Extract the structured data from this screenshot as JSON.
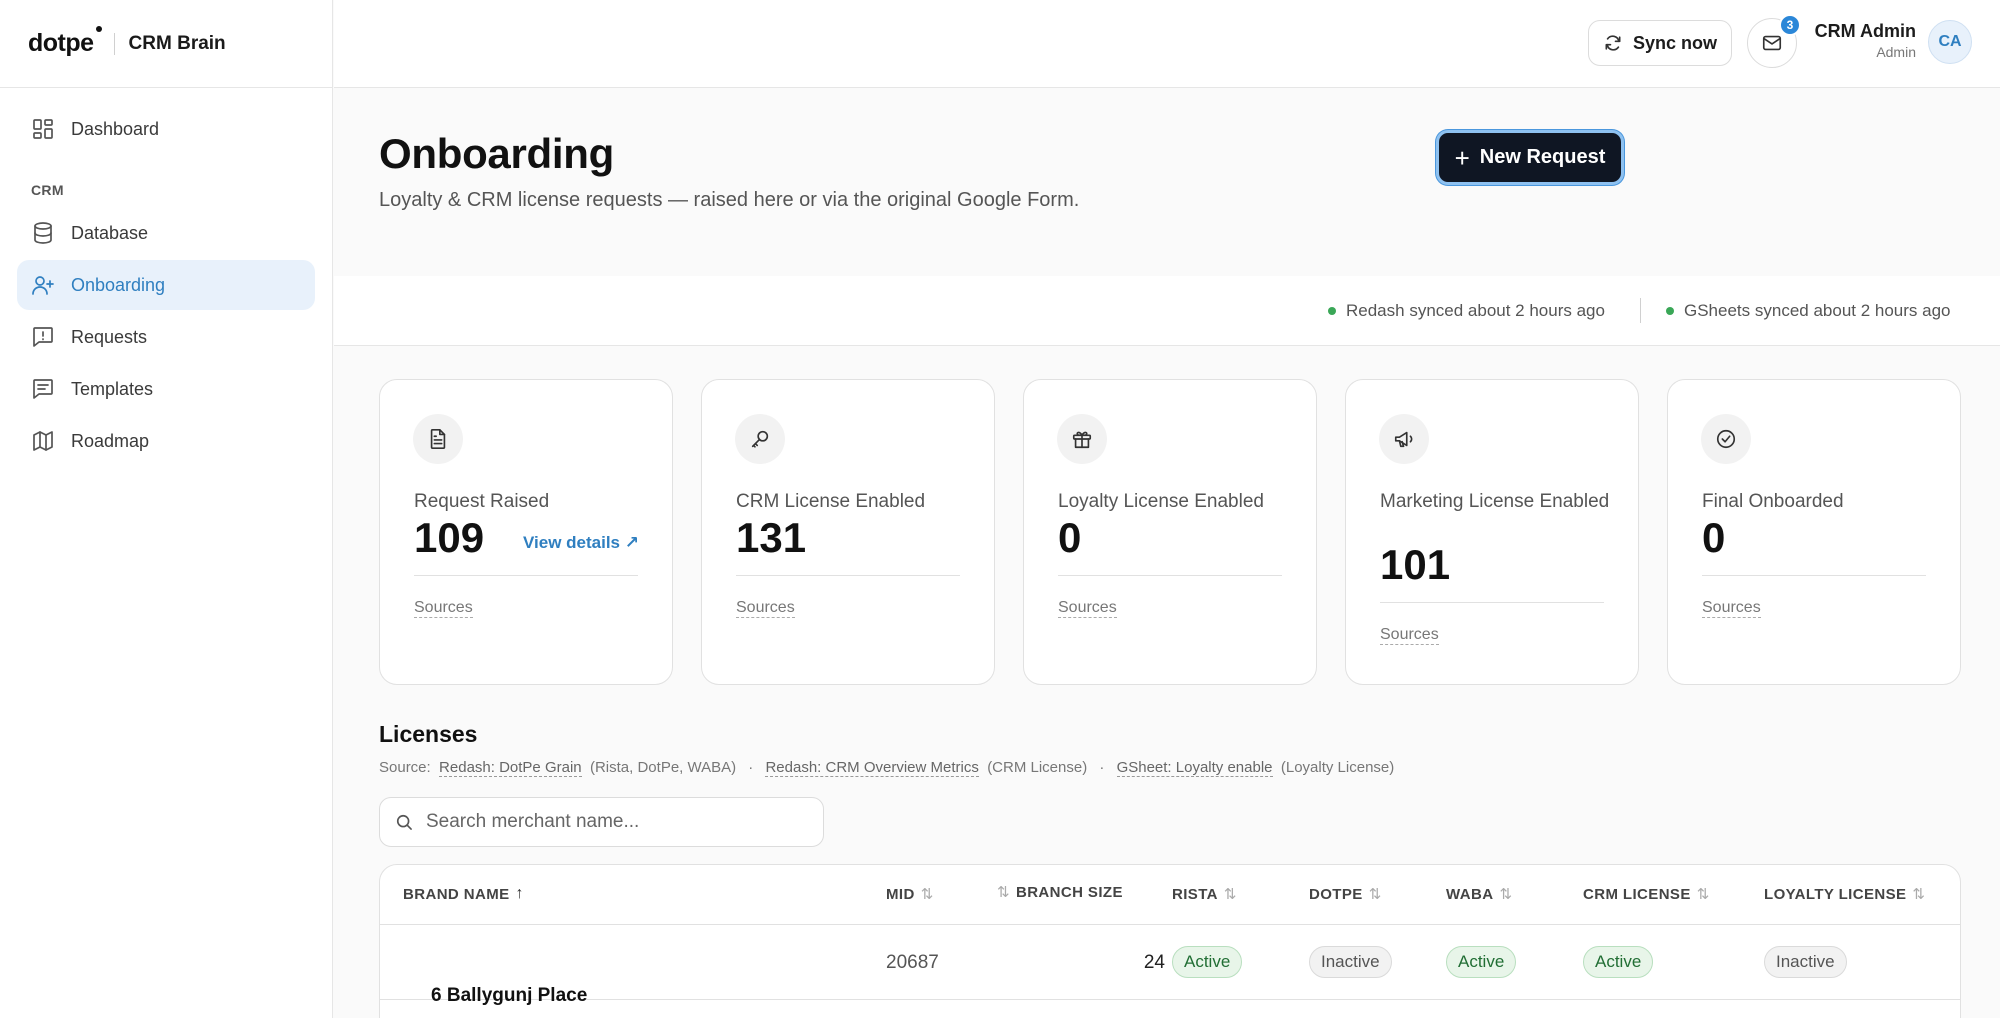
{
  "brand": {
    "logo": "dotpe",
    "name": "CRM Brain"
  },
  "sidebar": {
    "items_top": [
      {
        "label": "Dashboard",
        "icon": "dashboard-icon"
      }
    ],
    "section": "CRM",
    "items": [
      {
        "label": "Database",
        "icon": "database-icon"
      },
      {
        "label": "Onboarding",
        "icon": "user-plus-icon",
        "active": true
      },
      {
        "label": "Requests",
        "icon": "alert-message-icon"
      },
      {
        "label": "Templates",
        "icon": "message-lines-icon"
      },
      {
        "label": "Roadmap",
        "icon": "map-icon"
      }
    ]
  },
  "topbar": {
    "sync_label": "Sync now",
    "mail_badge": "3",
    "user_name": "CRM Admin",
    "user_role": "Admin",
    "avatar_initials": "CA"
  },
  "header": {
    "title": "Onboarding",
    "subtitle": "Loyalty & CRM license requests — raised here or via the original Google Form.",
    "new_request_label": "New Request"
  },
  "sync_status": [
    {
      "text": "Redash synced about 2 hours ago"
    },
    {
      "text": "GSheets synced about 2 hours ago"
    }
  ],
  "cards": [
    {
      "label": "Request Raised",
      "value": "109",
      "link": "View details ↗",
      "sources": "Sources",
      "icon": "document-icon"
    },
    {
      "label": "CRM License Enabled",
      "value": "131",
      "sources": "Sources",
      "icon": "key-icon"
    },
    {
      "label": "Loyalty License Enabled",
      "value": "0",
      "sources": "Sources",
      "icon": "gift-icon"
    },
    {
      "label": "Marketing License Enabled",
      "value": "101",
      "sources": "Sources",
      "icon": "megaphone-icon"
    },
    {
      "label": "Final Onboarded",
      "value": "0",
      "sources": "Sources",
      "icon": "check-circle-icon"
    }
  ],
  "licenses": {
    "title": "Licenses",
    "source_prefix": "Source:",
    "sources": [
      {
        "link": "Redash: DotPe Grain",
        "note": "(Rista, DotPe, WABA)"
      },
      {
        "link": "Redash: CRM Overview Metrics",
        "note": "(CRM License)"
      },
      {
        "link": "GSheet: Loyalty enable",
        "note": "(Loyalty License)"
      }
    ],
    "separator": "·",
    "search_placeholder": "Search merchant name...",
    "columns": [
      "BRAND NAME",
      "MID",
      "BRANCH SIZE",
      "RISTA",
      "DOTPE",
      "WABA",
      "CRM LICENSE",
      "LOYALTY LICENSE"
    ],
    "rows": [
      {
        "brand": "6 Ballygunj Place",
        "mid": "20687",
        "branch_size": "24",
        "rista": "Active",
        "dotpe": "Inactive",
        "waba": "Active",
        "crm": "Active",
        "loyalty": "Inactive"
      }
    ]
  },
  "colors": {
    "accent": "#2f7fc0",
    "active_green": "#216e34",
    "primary_button": "#0f1623"
  }
}
